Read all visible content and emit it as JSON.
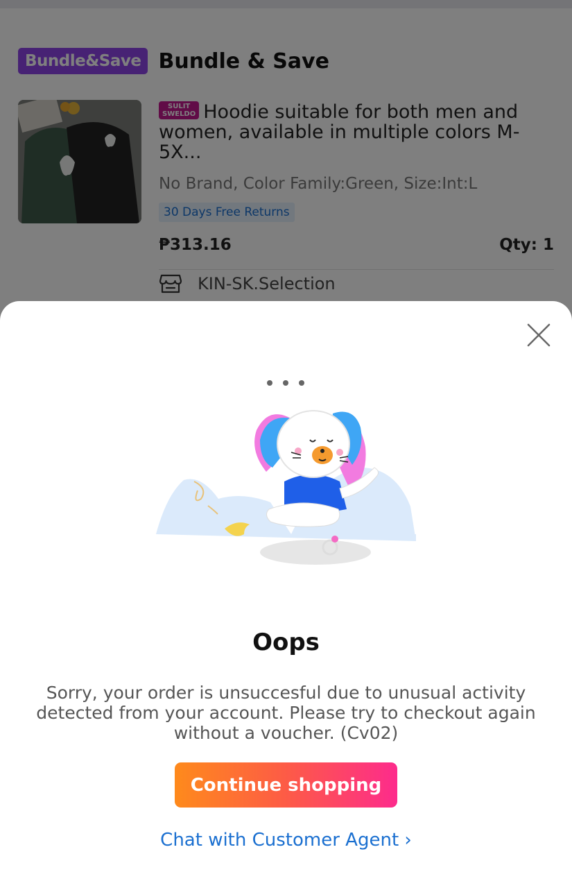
{
  "background": {
    "bundle_badge": "Bundle&Save",
    "bundle_title": "Bundle & Save",
    "product": {
      "promo_tag_line1": "SULIT",
      "promo_tag_line2": "SWELDO",
      "title": "Hoodie suitable for both men and women, available in multiple colors M-5X...",
      "variant": "No Brand, Color Family:Green, Size:Int:L",
      "returns_tag": "30 Days Free Returns",
      "price": "₱313.16",
      "qty": "Qty: 1",
      "store_name": "KIN-SK.Selection"
    }
  },
  "dialog": {
    "title": "Oops",
    "message": "Sorry, your order is unsuccesful due to unusual activity detected from your account. Please try to checkout again without a voucher. (Cv02)",
    "primary_button": "Continue shopping",
    "secondary_link": "Chat with Customer Agent ›",
    "icons": {
      "close": "close-icon",
      "store": "store-icon"
    }
  },
  "colors": {
    "bundle_badge": "#8e44e8",
    "promo_tag": "#c2188f",
    "link_blue": "#1a6fd0",
    "button_gradient_start": "#fe8a1c",
    "button_gradient_end": "#fd2b8c"
  }
}
